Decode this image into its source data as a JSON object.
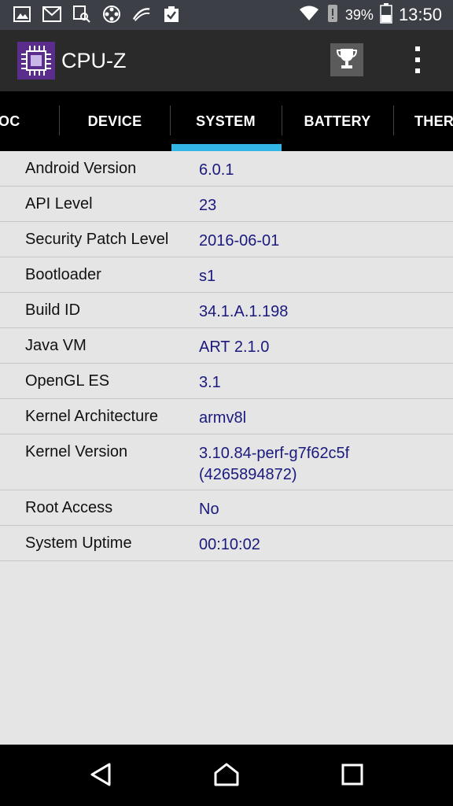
{
  "status_bar": {
    "battery_percent": "39%",
    "time": "13:50"
  },
  "app_bar": {
    "title": "CPU-Z"
  },
  "tabs": [
    {
      "label": "OC",
      "active": false
    },
    {
      "label": "DEVICE",
      "active": false
    },
    {
      "label": "SYSTEM",
      "active": true
    },
    {
      "label": "BATTERY",
      "active": false
    },
    {
      "label": "THER",
      "active": false
    }
  ],
  "info_rows": [
    {
      "label": "Android Version",
      "value": "6.0.1"
    },
    {
      "label": "API Level",
      "value": "23"
    },
    {
      "label": "Security Patch Level",
      "value": "2016-06-01"
    },
    {
      "label": "Bootloader",
      "value": "s1"
    },
    {
      "label": "Build ID",
      "value": "34.1.A.1.198"
    },
    {
      "label": "Java VM",
      "value": "ART 2.1.0"
    },
    {
      "label": "OpenGL ES",
      "value": "3.1"
    },
    {
      "label": "Kernel Architecture",
      "value": "armv8l"
    },
    {
      "label": "Kernel Version",
      "value": "3.10.84-perf-g7f62c5f (4265894872)"
    },
    {
      "label": "Root Access",
      "value": "No"
    },
    {
      "label": "System Uptime",
      "value": "00:10:02"
    }
  ],
  "colors": {
    "tab_indicator": "#33b5e5",
    "value_text": "#1a1a7e",
    "app_icon_bg": "#5a2d8c"
  }
}
